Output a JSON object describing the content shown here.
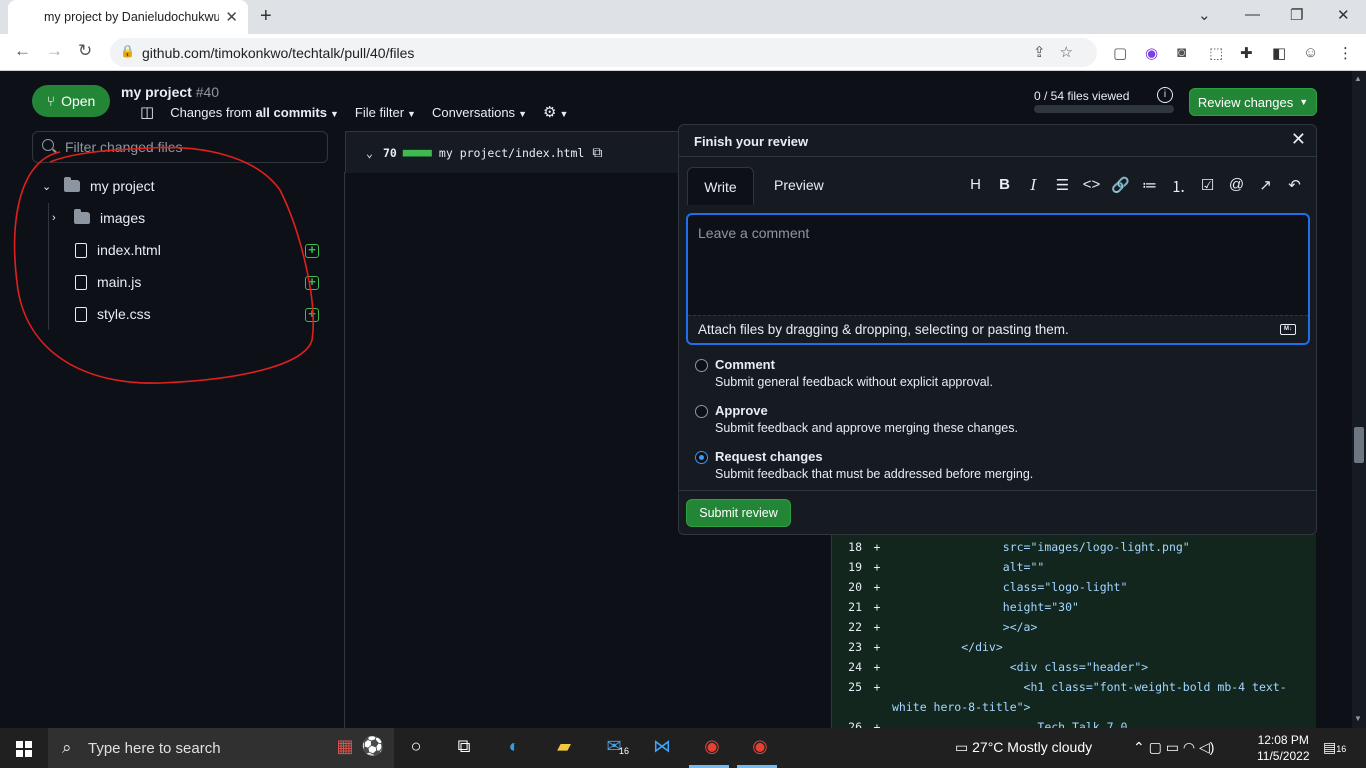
{
  "browser": {
    "tab_title": "my project by Danieludochukwu",
    "url": "github.com/timokonkwo/techtalk/pull/40/files"
  },
  "header": {
    "status": "Open",
    "title": "my project",
    "number": "#40",
    "changes_label": "Changes from ",
    "changes_strong": "all commits",
    "file_filter": "File filter",
    "conversations": "Conversations",
    "files_viewed": "0 / 54 files viewed",
    "files_viewed_fraction": 0,
    "review_button": "Review changes"
  },
  "filetree": {
    "filter_placeholder": "Filter changed files",
    "root": "my project",
    "folder": "images",
    "files": [
      "index.html",
      "main.js",
      "style.css"
    ]
  },
  "diff": {
    "count": "70",
    "path": "my project/index.html",
    "lines": [
      {
        "num": "18",
        "sign": "+",
        "code": "                src=\"images/logo-light.png\""
      },
      {
        "num": "19",
        "sign": "+",
        "code": "                alt=\"\""
      },
      {
        "num": "20",
        "sign": "+",
        "code": "                class=\"logo-light\""
      },
      {
        "num": "21",
        "sign": "+",
        "code": "                height=\"30\""
      },
      {
        "num": "22",
        "sign": "+",
        "code": "                ></a>"
      },
      {
        "num": "23",
        "sign": "+",
        "code": "          </div>"
      },
      {
        "num": "24",
        "sign": "+",
        "code": "                 <div class=\"header\">"
      },
      {
        "num": "25",
        "sign": "+",
        "code": "                   <h1 class=\"font-weight-bold mb-4 text-"
      },
      {
        "num": "",
        "sign": "",
        "code": "white hero-8-title\">"
      },
      {
        "num": "26",
        "sign": "+",
        "code": "                     Tech Talk 7.0"
      }
    ]
  },
  "review": {
    "title": "Finish your review",
    "tab_write": "Write",
    "tab_preview": "Preview",
    "placeholder": "Leave a comment",
    "attach": "Attach files by dragging & dropping, selecting or pasting them.",
    "options": [
      {
        "label": "Comment",
        "desc": "Submit general feedback without explicit approval."
      },
      {
        "label": "Approve",
        "desc": "Submit feedback and approve merging these changes."
      },
      {
        "label": "Request changes",
        "desc": "Submit feedback that must be addressed before merging."
      }
    ],
    "submit": "Submit review"
  },
  "taskbar": {
    "search": "Type here to search",
    "weather": "27°C  Mostly cloudy",
    "time": "12:08 PM",
    "date": "11/5/2022",
    "mail_badge": "16",
    "notif_badge": "16"
  },
  "colors": {
    "accent_green": "#238636",
    "focus_blue": "#1f6feb",
    "annotation_red": "#e0201c"
  }
}
